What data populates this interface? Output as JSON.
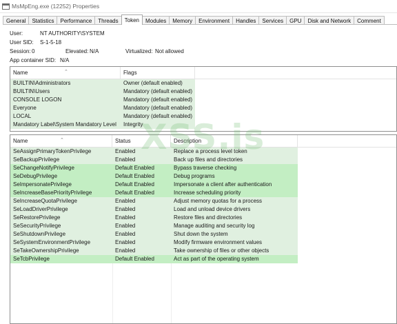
{
  "window": {
    "title": "MsMpEng.exe (12252) Properties"
  },
  "tabs": [
    "General",
    "Statistics",
    "Performance",
    "Threads",
    "Token",
    "Modules",
    "Memory",
    "Environment",
    "Handles",
    "Services",
    "GPU",
    "Disk and Network",
    "Comment"
  ],
  "active_tab": "Token",
  "info": {
    "user_label": "User:",
    "user_value": "NT AUTHORITY\\SYSTEM",
    "sid_label": "User SID:",
    "sid_value": "S-1-5-18",
    "session_label": "Session:",
    "session_value": "0",
    "elevated_label": "Elevated:",
    "elevated_value": "N/A",
    "virtualized_label": "Virtualized:",
    "virtualized_value": "Not allowed",
    "appcontainer_label": "App container SID:",
    "appcontainer_value": "N/A"
  },
  "groups": {
    "headers": [
      "Name",
      "Flags"
    ],
    "rows": [
      {
        "name": "BUILTIN\\Administrators",
        "flags": "Owner (default enabled)"
      },
      {
        "name": "BUILTIN\\Users",
        "flags": "Mandatory (default enabled)"
      },
      {
        "name": "CONSOLE LOGON",
        "flags": "Mandatory (default enabled)"
      },
      {
        "name": "Everyone",
        "flags": "Mandatory (default enabled)"
      },
      {
        "name": "LOCAL",
        "flags": "Mandatory (default enabled)"
      },
      {
        "name": "Mandatory Label\\System Mandatory Level",
        "flags": "Integrity"
      }
    ]
  },
  "privileges": {
    "headers": [
      "Name",
      "Status",
      "Description"
    ],
    "rows": [
      {
        "name": "SeAssignPrimaryTokenPrivilege",
        "status": "Enabled",
        "description": "Replace a process level token",
        "default": false
      },
      {
        "name": "SeBackupPrivilege",
        "status": "Enabled",
        "description": "Back up files and directories",
        "default": false
      },
      {
        "name": "SeChangeNotifyPrivilege",
        "status": "Default Enabled",
        "description": "Bypass traverse checking",
        "default": true
      },
      {
        "name": "SeDebugPrivilege",
        "status": "Default Enabled",
        "description": "Debug programs",
        "default": true
      },
      {
        "name": "SeImpersonatePrivilege",
        "status": "Default Enabled",
        "description": "Impersonate a client after authentication",
        "default": true
      },
      {
        "name": "SeIncreaseBasePriorityPrivilege",
        "status": "Default Enabled",
        "description": "Increase scheduling priority",
        "default": true
      },
      {
        "name": "SeIncreaseQuotaPrivilege",
        "status": "Enabled",
        "description": "Adjust memory quotas for a process",
        "default": false
      },
      {
        "name": "SeLoadDriverPrivilege",
        "status": "Enabled",
        "description": "Load and unload device drivers",
        "default": false
      },
      {
        "name": "SeRestorePrivilege",
        "status": "Enabled",
        "description": "Restore files and directories",
        "default": false
      },
      {
        "name": "SeSecurityPrivilege",
        "status": "Enabled",
        "description": "Manage auditing and security log",
        "default": false
      },
      {
        "name": "SeShutdownPrivilege",
        "status": "Enabled",
        "description": "Shut down the system",
        "default": false
      },
      {
        "name": "SeSystemEnvironmentPrivilege",
        "status": "Enabled",
        "description": "Modify firmware environment values",
        "default": false
      },
      {
        "name": "SeTakeOwnershipPrivilege",
        "status": "Enabled",
        "description": "Take ownership of files or other objects",
        "default": false
      },
      {
        "name": "SeTcbPrivilege",
        "status": "Default Enabled",
        "description": "Act as part of the operating system",
        "default": true
      }
    ]
  },
  "colors": {
    "enabled_row": "#e0f0e0",
    "default_enabled_row": "#c3eec3",
    "group_row": "#e0f0e0"
  },
  "watermark": "XSS.is"
}
